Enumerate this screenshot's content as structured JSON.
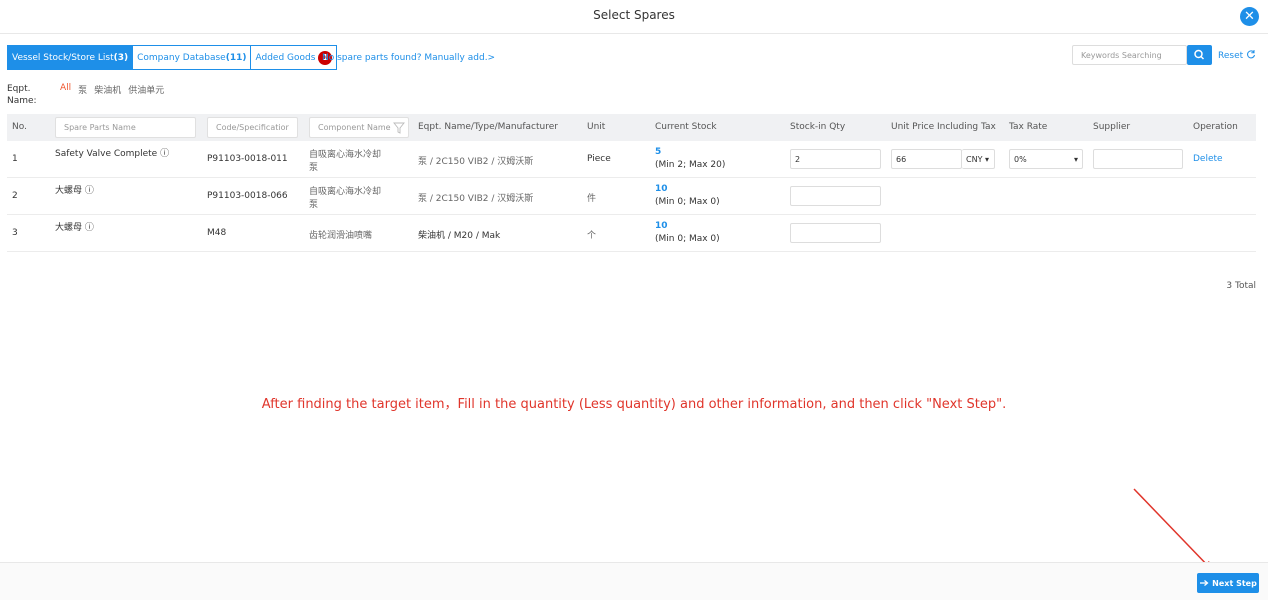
{
  "header": {
    "title": "Select Spares",
    "close_icon": "close-icon"
  },
  "tabs": [
    {
      "label": "Vessel Stock/Store List",
      "count": "(3)",
      "active": true
    },
    {
      "label": "Company Database",
      "count": "(11)",
      "active": false
    },
    {
      "label": "Added Goods",
      "badge": "1",
      "active": false
    }
  ],
  "manual_add": "No spare parts found? Manually add.>",
  "search": {
    "placeholder": "Keywords Searching",
    "reset": "Reset"
  },
  "filter": {
    "label": "Eqpt. Name:",
    "options": [
      "All",
      "泵",
      "柴油机",
      "供油单元"
    ],
    "selected": "All"
  },
  "table": {
    "columns": {
      "no": "No.",
      "spare_name_placeholder": "Spare Parts Name",
      "code_placeholder": "Code/Specificatior",
      "component_placeholder": "Component Name",
      "eqpt": "Eqpt. Name/Type/Manufacturer",
      "unit": "Unit",
      "stock": "Current Stock",
      "qty": "Stock-in Qty",
      "price": "Unit Price Including Tax",
      "tax": "Tax Rate",
      "supplier": "Supplier",
      "operation": "Operation"
    },
    "rows": [
      {
        "no": "1",
        "name": "Safety Valve Complete ⓘ",
        "code": "P91103-0018-011",
        "component_l1": "自吸离心海水冷却",
        "component_l2": "泵",
        "eqpt": "泵 / 2C150 VIB2 / 汉姆沃斯",
        "unit": "Piece",
        "stock": "5",
        "stock_range": "(Min 2; Max 20)",
        "qty": "2",
        "price": "66",
        "currency": "CNY ▾",
        "tax": "0%",
        "tax_arrow": "▾",
        "operation": "Delete"
      },
      {
        "no": "2",
        "name": "大螺母 ⓘ",
        "code": "P91103-0018-066",
        "component_l1": "自吸离心海水冷却",
        "component_l2": "泵",
        "eqpt": "泵 / 2C150 VIB2 / 汉姆沃斯",
        "unit": "件",
        "stock": "10",
        "stock_range": "(Min 0; Max 0)"
      },
      {
        "no": "3",
        "name": "大螺母 ⓘ",
        "code": "M48",
        "component_l1": "齿轮润滑油喷嘴",
        "eqpt": "柴油机 / M20 / Mak",
        "unit": "个",
        "stock": "10",
        "stock_range": "(Min 0; Max 0)"
      }
    ]
  },
  "total": "3 Total",
  "notice": "After finding the target item，Fill in the quantity (Less quantity) and other information, and then click \"Next Step\".",
  "next_step": "Next Step"
}
